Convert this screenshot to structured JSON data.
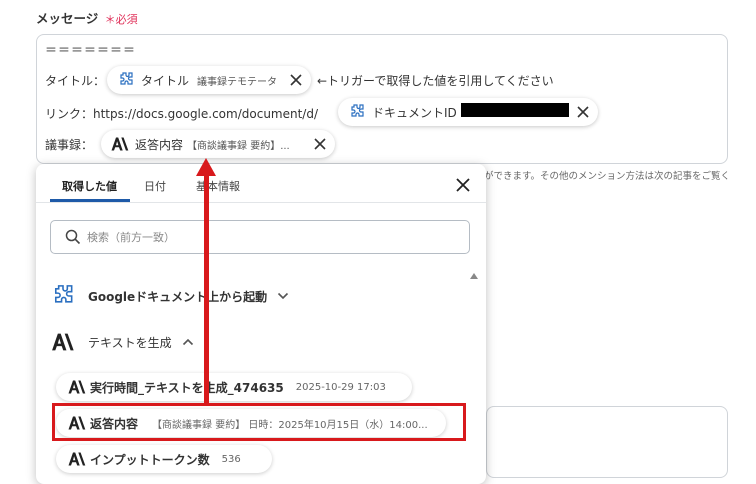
{
  "field": {
    "label": "メッセージ",
    "required_mark": "＊",
    "required_text": "必須"
  },
  "message": {
    "separator": "＝＝＝＝＝＝＝",
    "title_prefix": "タイトル：",
    "title_chip": {
      "name": "タイトル",
      "value": "議事録テモテータ"
    },
    "title_suffix": "←トリガーで取得した値を引用してください",
    "link_prefix": "リンク：https://docs.google.com/document/d/",
    "link_chip": {
      "name": "ドキュメントID"
    },
    "minutes_prefix": "議事録：",
    "minutes_chip": {
      "name": "返答内容",
      "value": "【商談議事録 要約】..."
    }
  },
  "hint_text": "ができます。その他のメンション方法は次の記事をご覧く",
  "panel": {
    "tabs": [
      "取得した値",
      "日付",
      "基本情報"
    ],
    "active_tab": 0,
    "search_placeholder": "検索（前方一致）",
    "groups": [
      {
        "label": "Googleドキュメント上から起動",
        "icon": "puzzle-icon",
        "state": "collapsed"
      },
      {
        "label": "テキストを生成",
        "icon": "anthropic-icon",
        "state": "expanded"
      }
    ],
    "options": [
      {
        "name": "実行時間_テキストを生成_474635",
        "value": "2025-10-29 17:03"
      },
      {
        "name": "返答内容",
        "value": "【商談議事録 要約】 日時：2025年10月15日（水）14:00..."
      },
      {
        "name": "インプットトークン数",
        "value": "536"
      }
    ]
  },
  "colors": {
    "highlight": "#d8191c",
    "tab_underline": "#1e5aa8",
    "required": "#e0315a"
  }
}
